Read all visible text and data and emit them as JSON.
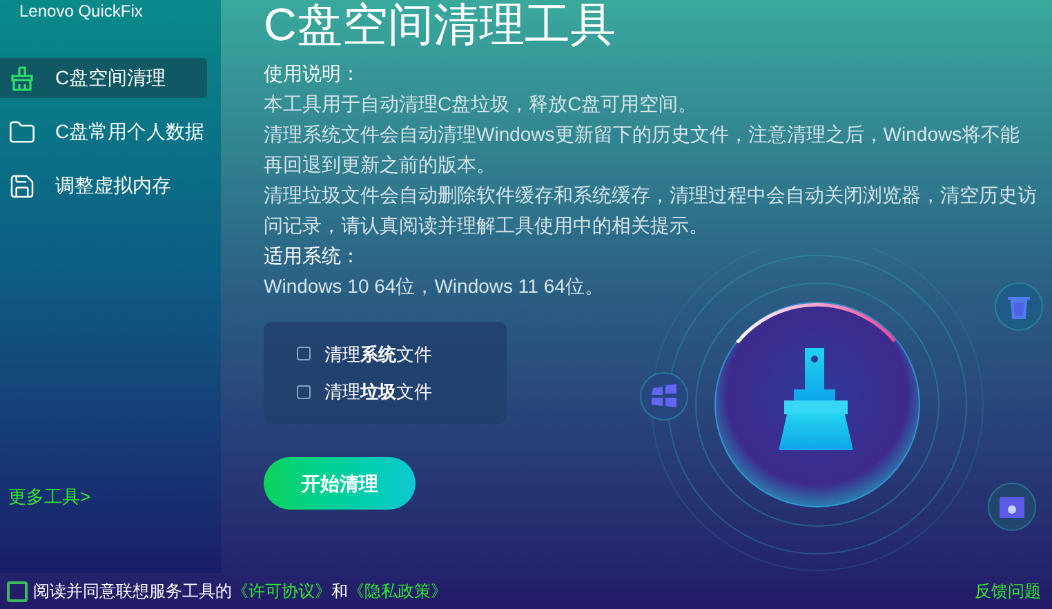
{
  "app": {
    "title": "Lenovo QuickFix"
  },
  "sidebar": {
    "items": [
      {
        "label": "C盘空间清理",
        "selected": true
      },
      {
        "label": "C盘常用个人数据",
        "selected": false
      },
      {
        "label": "调整虚拟内存",
        "selected": false
      }
    ],
    "more_tools": "更多工具>"
  },
  "main": {
    "title": "C盘空间清理工具",
    "description": [
      {
        "kind": "heading",
        "text": "使用说明："
      },
      {
        "kind": "paragraph",
        "text": "本工具用于自动清理C盘垃圾，释放C盘可用空间。"
      },
      {
        "kind": "paragraph",
        "text": "清理系统文件会自动清理Windows更新留下的历史文件，注意清理之后，Windows将不能再回退到更新之前的版本。"
      },
      {
        "kind": "paragraph",
        "text": "清理垃圾文件会自动删除软件缓存和系统缓存，清理过程中会自动关闭浏览器，清空历史访问记录，请认真阅读并理解工具使用中的相关提示。"
      },
      {
        "kind": "heading",
        "text": "适用系统："
      },
      {
        "kind": "paragraph",
        "text": "Windows 10 64位，Windows 11 64位。"
      }
    ],
    "options": [
      {
        "label": "清理**系统**文件",
        "checked": false
      },
      {
        "label": "清理**垃圾**文件",
        "checked": false
      }
    ],
    "start_button": "开始清理"
  },
  "footer": {
    "agree_checked": false,
    "agree_text": "阅读并同意联想服务工具的",
    "license_link": "《许可协议》",
    "and": "和",
    "privacy_link": "《隐私政策》",
    "feedback": "反馈问题"
  }
}
